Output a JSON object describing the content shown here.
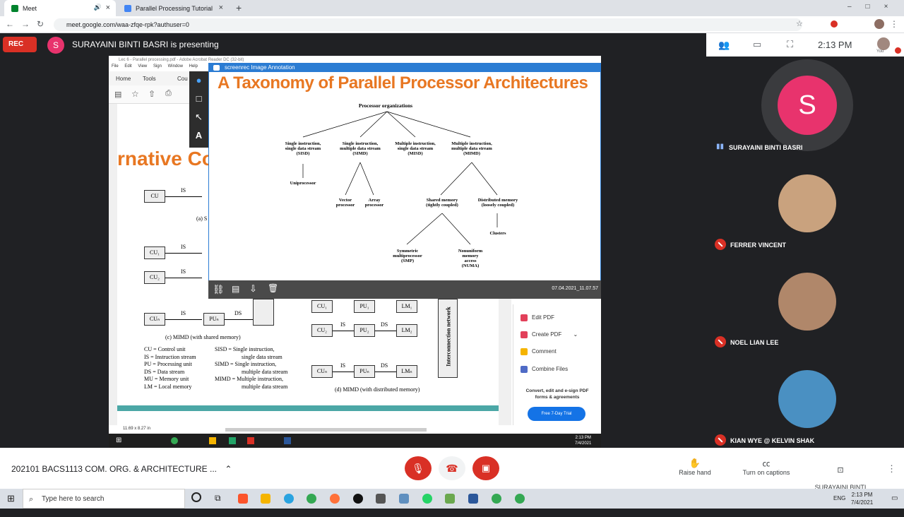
{
  "browser": {
    "tabs": [
      {
        "label": "Meet",
        "active": true
      },
      {
        "label": "Parallel Processing Tutorial",
        "active": false
      }
    ],
    "url": "meet.google.com/waa-zfqe-rpk?authuser=0"
  },
  "meet": {
    "rec_label": "REC",
    "presenter_initial": "S",
    "presenting_text": "SURAYAINI BINTI BASRI is presenting",
    "clock": "2:13 PM",
    "you_label": "You",
    "meeting_name": "202101 BACS1113 COM. ORG. & ARCHITECTURE ...",
    "participants": [
      {
        "name": "SURAYAINI BINTI BASRI",
        "initial": "S",
        "muted": false
      },
      {
        "name": "FERRER VINCENT",
        "muted": true
      },
      {
        "name": "NOEL LIAN LEE",
        "muted": true
      },
      {
        "name": "KIAN WYE @ KELVIN SHAK",
        "muted": true
      }
    ],
    "right_controls": [
      {
        "label": "Raise hand"
      },
      {
        "label": "Turn on captions"
      },
      {
        "label": "SURAYAINI BINTI BASRI\nis presenting"
      }
    ]
  },
  "shared": {
    "acrobat_title": "Lec 6 - Parallel processing.pdf - Adobe Acrobat Reader DC (32-bit)",
    "menu": [
      "File",
      "Edit",
      "View",
      "Sign",
      "Window",
      "Help"
    ],
    "tabs": [
      "Home",
      "Tools",
      "Cou"
    ],
    "heading_fragment": "rnative Co",
    "right_panel": {
      "items": [
        "Edit PDF",
        "Create PDF",
        "Comment",
        "Combine Files"
      ],
      "promo": "Convert, edit and e-sign PDF forms & agreements",
      "trial": "Free 7-Day Trial"
    },
    "page_size": "11.69 x 8.27 in",
    "labels": {
      "cu": "CU",
      "cu1": "CU₁",
      "cu2": "CU₂",
      "cun": "CUₙ",
      "is": "IS",
      "ds": "DS",
      "pun": "PUₙ",
      "pu1": "PU₁",
      "pu2": "PU₂",
      "lm1": "LM₁",
      "lm2": "LM₂",
      "lmn": "LMₙ",
      "a_caption": "(a) S",
      "c_caption": "(c) MIMD (with shared memory)",
      "d_caption": "(d) MIMD (with distributed memory)",
      "interconnect": "Interconnection network"
    },
    "legend_left": [
      "CU = Control unit",
      "IS  = Instruction stream",
      "PU = Processing unit",
      "DS = Data stream",
      "MU = Memory unit",
      "LM = Local memory"
    ],
    "legend_right": [
      "SISD  = Single instruction,",
      "single data stream",
      "SIMD  = Single instruction,",
      "multiple data stream",
      "MIMD = Multiple instruction,",
      "multiple data stream"
    ],
    "win_clock": [
      "2:13 PM",
      "7/4/2021"
    ]
  },
  "annotation": {
    "app": "screenrec Image Annotation",
    "title": "A Taxonomy of Parallel Processor Architectures",
    "date": "07.04.2021_11.07.57",
    "tree": {
      "root": "Processor organizations",
      "sisd": "Single instruction,\nsingle data stream\n(SISD)",
      "simd": "Single instruction,\nmultiple data stream\n(SIMD)",
      "misd": "Multiple instruction,\nsingle data stream\n(MISD)",
      "mimd": "Multiple instruction,\nmultiple data stream\n(MIMD)",
      "uni": "Uniprocessor",
      "vector": "Vector\nprocessor",
      "array": "Array\nprocessor",
      "shared": "Shared memory\n(tightly coupled)",
      "distributed": "Distributed memory\n(loosely coupled)",
      "clusters": "Clusters",
      "smp": "Symmetric\nmultiprocessor\n(SMP)",
      "numa": "Nonuniform\nmemory\naccess\n(NUMA)"
    }
  },
  "taskbar": {
    "search_placeholder": "Type here to search",
    "lang": "ENG",
    "time": "2:13 PM",
    "date": "7/4/2021"
  },
  "colors": {
    "accent_red": "#d93025",
    "orange_title": "#e87722",
    "teal": "#4ba7a6"
  }
}
